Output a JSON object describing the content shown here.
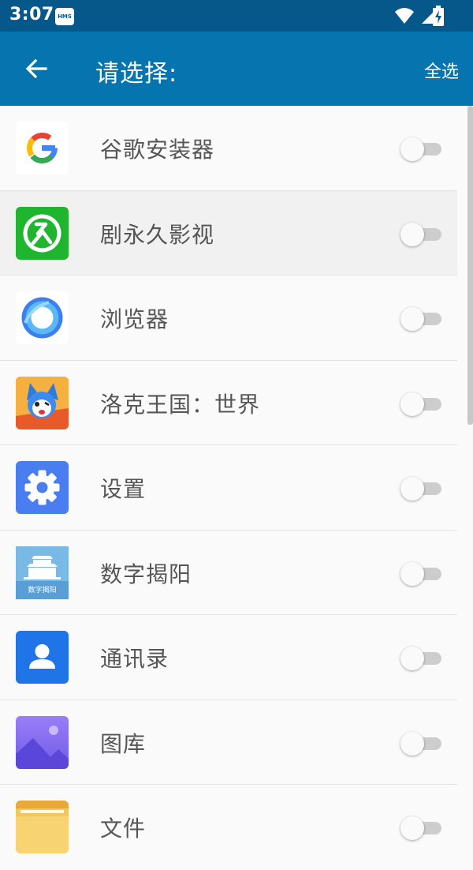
{
  "status_bar": {
    "time": "3:07",
    "badge": "HMS",
    "icons": [
      "wifi-icon",
      "signal-icon",
      "battery-charging-icon"
    ]
  },
  "app_bar": {
    "title": "请选择:",
    "select_all_label": "全选",
    "back_icon": "arrow-left-icon"
  },
  "apps": [
    {
      "label": "谷歌安装器",
      "icon": "google-icon",
      "enabled": false
    },
    {
      "label": "剧永久影视",
      "icon": "jiu-icon",
      "enabled": false
    },
    {
      "label": "浏览器",
      "icon": "browser-icon",
      "enabled": false
    },
    {
      "label": "洛克王国：世界",
      "icon": "roco-game-icon",
      "enabled": false
    },
    {
      "label": "设置",
      "icon": "settings-gear-icon",
      "enabled": false
    },
    {
      "label": "数字揭阳",
      "icon": "digital-jieyang-icon",
      "icon_text": "数字揭阳",
      "enabled": false
    },
    {
      "label": "通讯录",
      "icon": "contacts-icon",
      "enabled": false
    },
    {
      "label": "图库",
      "icon": "gallery-icon",
      "enabled": false
    },
    {
      "label": "文件",
      "icon": "files-folder-icon",
      "enabled": false
    }
  ],
  "colors": {
    "status_bar": "#06588a",
    "app_bar": "#0674ae",
    "background": "#fafafa",
    "toggle_track_off": "#cdcdcd"
  }
}
